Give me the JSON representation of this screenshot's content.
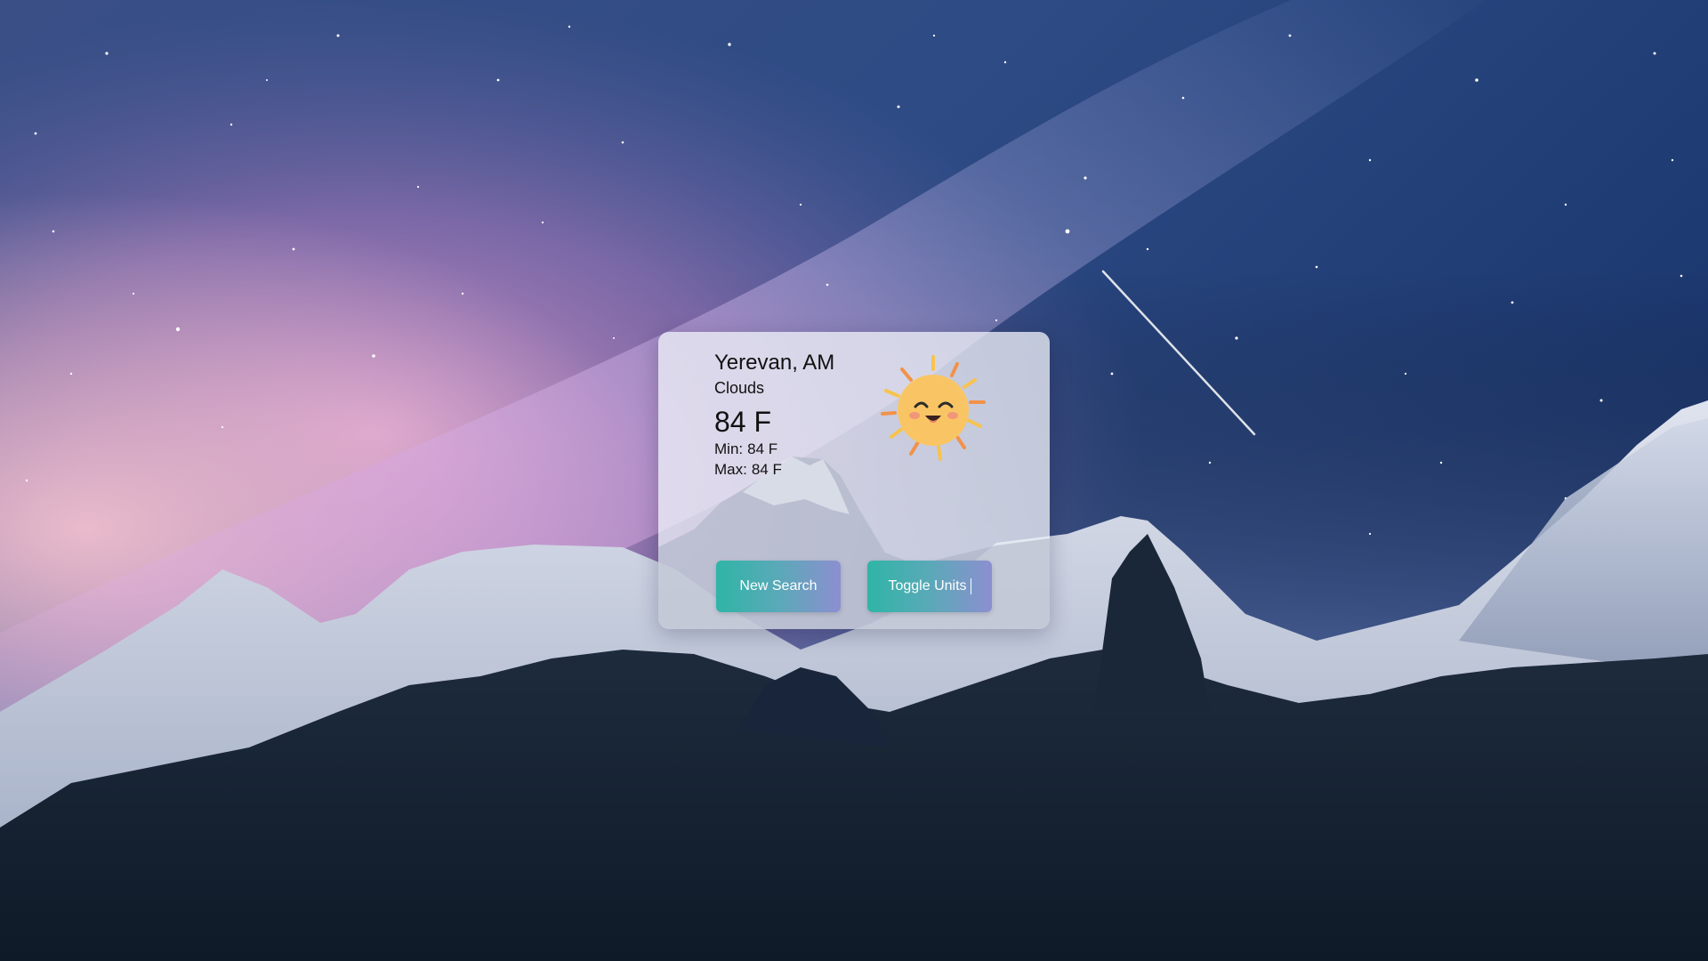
{
  "weather": {
    "city": "Yerevan, AM",
    "description": "Clouds",
    "temperature": "84 F",
    "min_label": "Min:",
    "min_value": "84 F",
    "max_label": "Max:",
    "max_value": "84 F",
    "icon": "sun-smiling-icon"
  },
  "actions": {
    "new_search_label": "New Search",
    "toggle_units_label": "Toggle Units"
  },
  "theme": {
    "button_gradient_start": "#2fb5a6",
    "button_gradient_end": "#8c8fd0",
    "sun_color": "#f9c564",
    "ray_orange": "#f2924a",
    "ray_yellow": "#f7c34e"
  }
}
